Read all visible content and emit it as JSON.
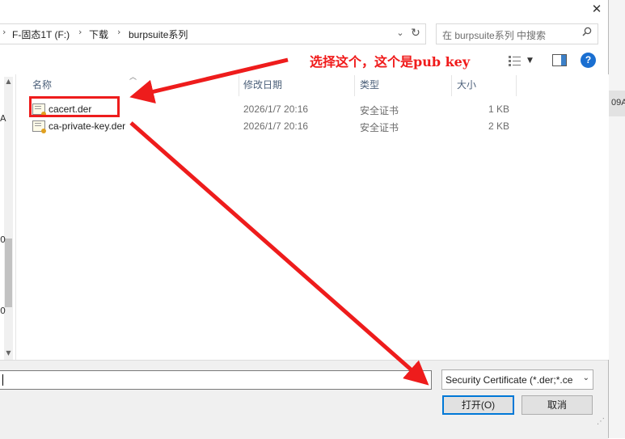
{
  "window": {
    "close_glyph": "✕"
  },
  "address_bar": {
    "crumbs": [
      "F-固态1T (F:)",
      "下载",
      "burpsuite系列"
    ],
    "separator": "›",
    "dropdown_glyph": "⌄",
    "refresh_glyph": "↻"
  },
  "search": {
    "placeholder": "在 burpsuite系列 中搜索",
    "icon": "search-icon"
  },
  "toolbar": {
    "help_label": "?"
  },
  "columns": {
    "name": "名称",
    "date": "修改日期",
    "type": "类型",
    "size": "大小"
  },
  "files": [
    {
      "name": "cacert.der",
      "date": "2026/1/7 20:16",
      "type": "安全证书",
      "size": "1 KB",
      "icon": "certificate-icon"
    },
    {
      "name": "ca-private-key.der",
      "date": "2026/1/7 20:16",
      "type": "安全证书",
      "size": "2 KB",
      "icon": "certificate-icon"
    }
  ],
  "filename": {
    "value": ""
  },
  "filetype": {
    "selected": "Security Certificate (*.der;*.ce",
    "dropdown_glyph": "⌄"
  },
  "buttons": {
    "open": "打开(O)",
    "cancel": "取消"
  },
  "annotation": {
    "text": "选择这个，这个是pub key",
    "color": "#ee1c1c"
  },
  "background_window": {
    "text": "09A"
  },
  "nav_pane": {
    "glyphs": [
      "A",
      "0",
      "0"
    ]
  }
}
